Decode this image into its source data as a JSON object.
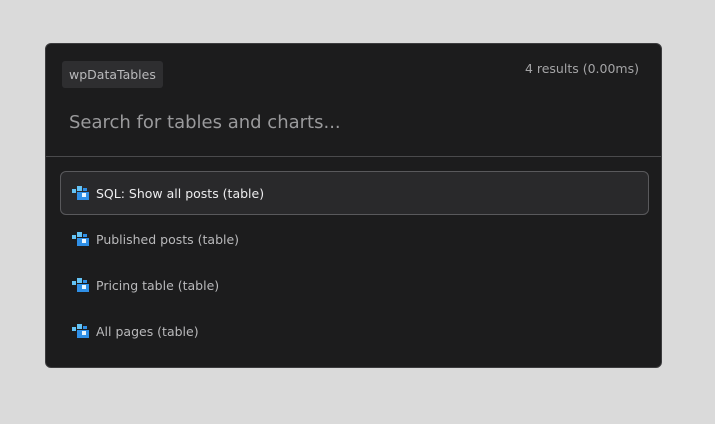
{
  "search": {
    "source_tag": "wpDataTables",
    "results_count": "4 results (0.00ms)",
    "placeholder": "Search for tables and charts...",
    "value": ""
  },
  "results": [
    {
      "label": "SQL: Show all posts (table)",
      "icon": "wpdatatables-icon",
      "active": true
    },
    {
      "label": "Published posts (table)",
      "icon": "wpdatatables-icon",
      "active": false
    },
    {
      "label": "Pricing table (table)",
      "icon": "wpdatatables-icon",
      "active": false
    },
    {
      "label": "All pages (table)",
      "icon": "wpdatatables-icon",
      "active": false
    }
  ],
  "colors": {
    "icon_primary": "#2f8fe6",
    "icon_secondary": "#64c3f5"
  }
}
